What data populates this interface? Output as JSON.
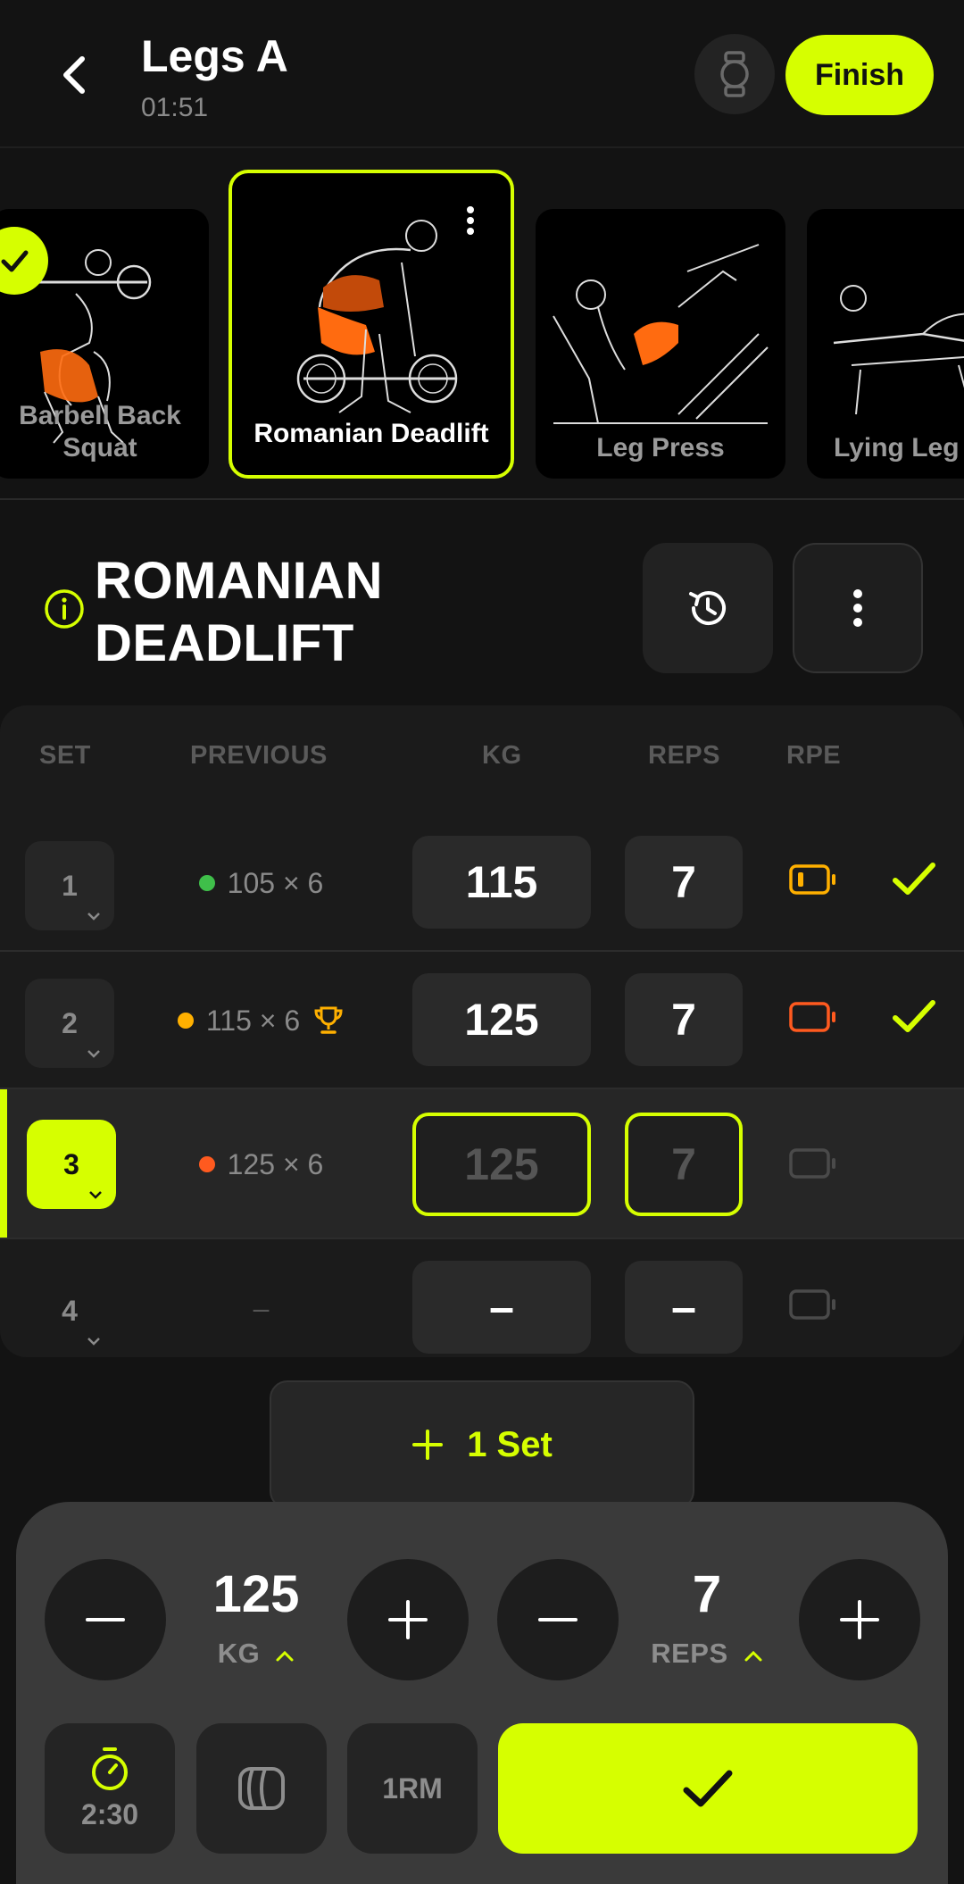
{
  "header": {
    "title": "Legs A",
    "elapsed": "01:51",
    "finish_label": "Finish"
  },
  "carousel": [
    {
      "label": "Barbell Back Squat",
      "completed": true
    },
    {
      "label": "Romanian Deadlift",
      "active": true
    },
    {
      "label": "Leg Press"
    },
    {
      "label": "Lying Leg"
    }
  ],
  "exercise": {
    "title_line1": "ROMANIAN",
    "title_line2": "DEADLIFT"
  },
  "table": {
    "headers": {
      "set": "SET",
      "previous": "PREVIOUS",
      "kg": "KG",
      "reps": "REPS",
      "rpe": "RPE"
    },
    "rows": [
      {
        "set": "1",
        "previous": "105 × 6",
        "dot_color": "#3fbf4a",
        "kg": "115",
        "reps": "7",
        "rpe_color": "#ffb000",
        "done": true
      },
      {
        "set": "2",
        "previous": "115 × 6",
        "dot_color": "#ffb000",
        "trophy": true,
        "kg": "125",
        "reps": "7",
        "rpe_color": "#ff5a1f",
        "done": true
      },
      {
        "set": "3",
        "previous": "125 × 6",
        "dot_color": "#ff5a1f",
        "kg": "125",
        "reps": "7",
        "current": true
      },
      {
        "set": "4",
        "previous": "–",
        "kg": "–",
        "reps": "–"
      }
    ]
  },
  "add_set_label": "1 Set",
  "panel": {
    "weight_value": "125",
    "weight_unit": "KG",
    "reps_value": "7",
    "reps_unit": "REPS",
    "rest_timer": "2:30",
    "one_rm_label": "1RM"
  },
  "colors": {
    "accent": "#d6ff00",
    "background": "#131313"
  }
}
